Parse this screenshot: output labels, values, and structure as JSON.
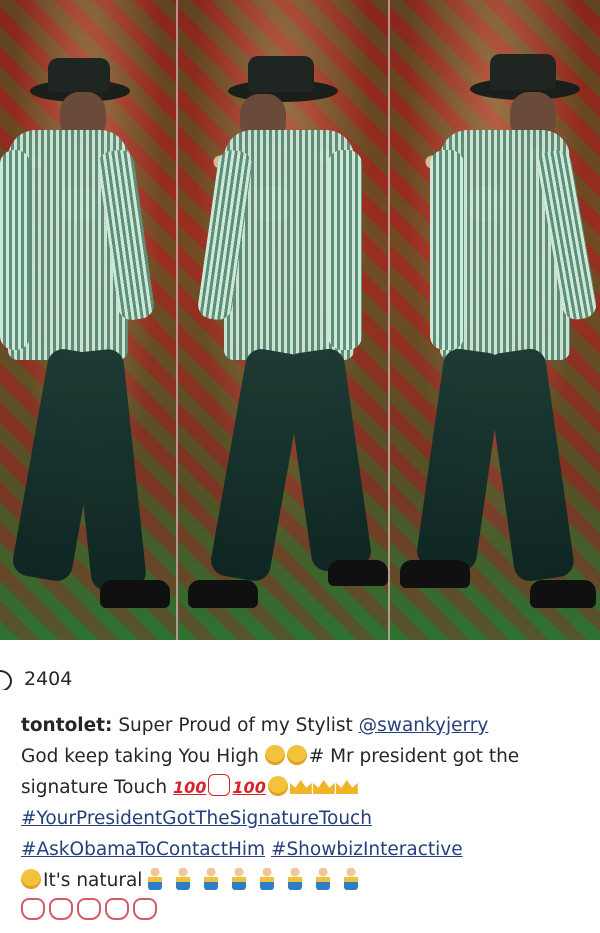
{
  "post": {
    "likes_count": "2404",
    "likes_icon": "heart-icon",
    "caption": {
      "username": "tontolet:",
      "text_1": "Super Proud of my Stylist",
      "mention": "@swankyjerry",
      "text_2": "God keep taking You High",
      "text_3": "# Mr president got the signature Touch",
      "hashtag_1": "#YourPresidentGotTheSignatureTouch",
      "hashtag_2": "#AskObamaToContactHim",
      "hashtag_3": "#ShowbizInteractive",
      "text_4": "It's natural",
      "emoji_100": "100"
    }
  },
  "colors": {
    "link": "#27407a",
    "text": "#262626"
  }
}
